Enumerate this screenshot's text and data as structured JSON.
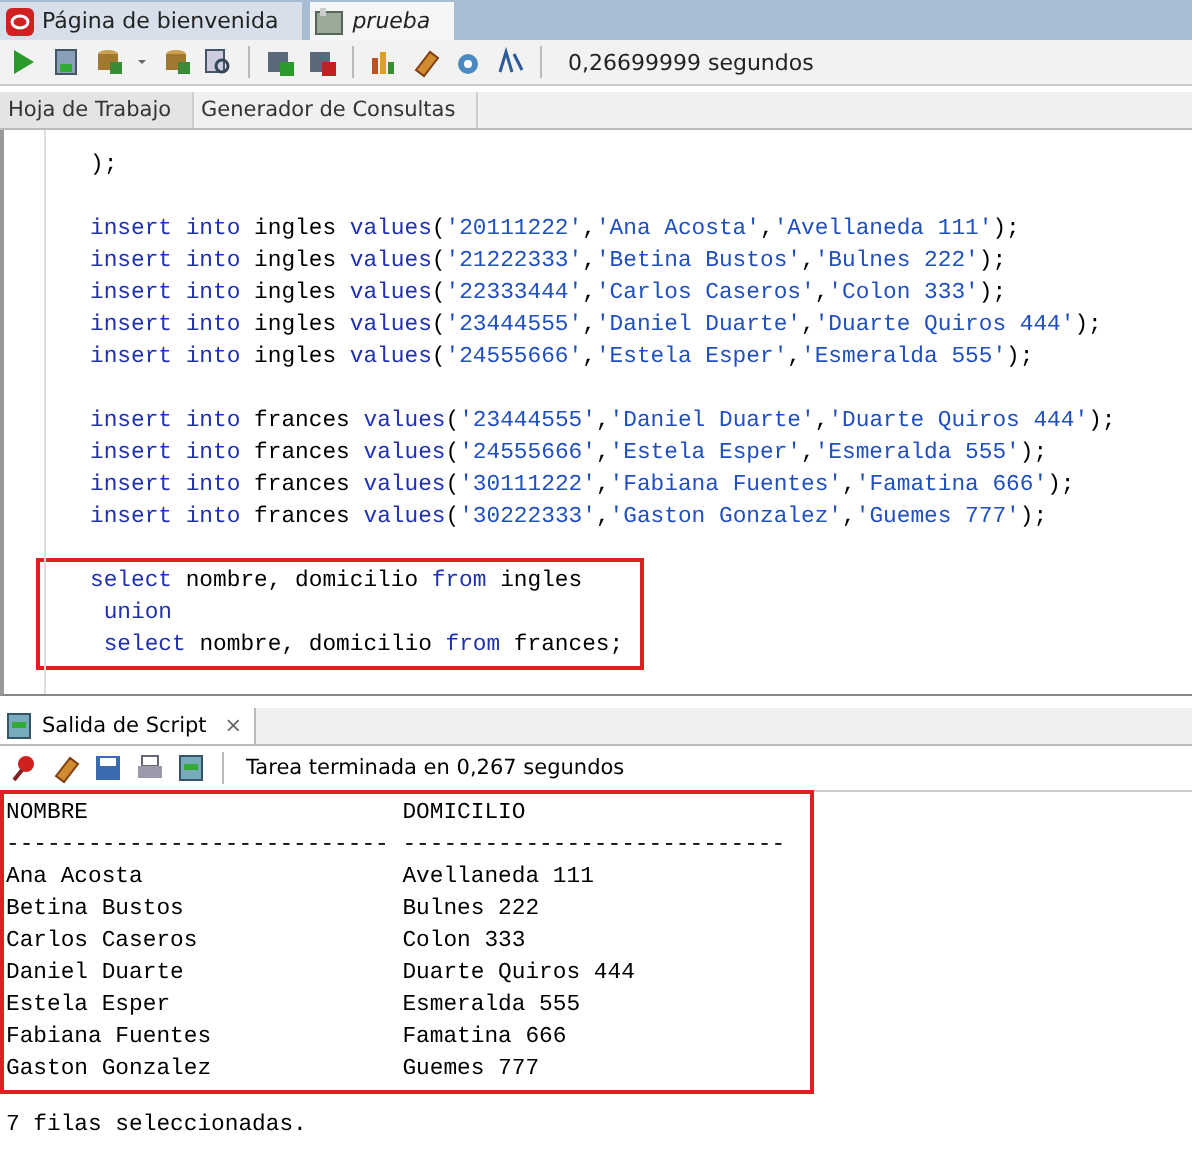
{
  "document_tabs": [
    {
      "label": "Página de bienvenida",
      "selected": false
    },
    {
      "label": "prueba",
      "selected": true
    }
  ],
  "toolbar": {
    "elapsed": "0,26699999 segundos"
  },
  "editor_tabs": [
    {
      "label": "Hoja de Trabajo",
      "selected": true
    },
    {
      "label": "Generador de Consultas",
      "selected": false
    }
  ],
  "editor": {
    "blocks": [
      {
        "highlighted": false,
        "lines": [
          [
            {
              "kind": "plain",
              "text": ");"
            }
          ]
        ]
      },
      {
        "highlighted": false,
        "lines": [
          [
            {
              "kind": "keyword",
              "text": "insert into"
            },
            {
              "kind": "plain",
              "text": " ingles "
            },
            {
              "kind": "keyword",
              "text": "values"
            },
            {
              "kind": "plain",
              "text": "("
            },
            {
              "kind": "string",
              "text": "'20111222'"
            },
            {
              "kind": "plain",
              "text": ","
            },
            {
              "kind": "string",
              "text": "'Ana Acosta'"
            },
            {
              "kind": "plain",
              "text": ","
            },
            {
              "kind": "string",
              "text": "'Avellaneda 111'"
            },
            {
              "kind": "plain",
              "text": ");"
            }
          ],
          [
            {
              "kind": "keyword",
              "text": "insert into"
            },
            {
              "kind": "plain",
              "text": " ingles "
            },
            {
              "kind": "keyword",
              "text": "values"
            },
            {
              "kind": "plain",
              "text": "("
            },
            {
              "kind": "string",
              "text": "'21222333'"
            },
            {
              "kind": "plain",
              "text": ","
            },
            {
              "kind": "string",
              "text": "'Betina Bustos'"
            },
            {
              "kind": "plain",
              "text": ","
            },
            {
              "kind": "string",
              "text": "'Bulnes 222'"
            },
            {
              "kind": "plain",
              "text": ");"
            }
          ],
          [
            {
              "kind": "keyword",
              "text": "insert into"
            },
            {
              "kind": "plain",
              "text": " ingles "
            },
            {
              "kind": "keyword",
              "text": "values"
            },
            {
              "kind": "plain",
              "text": "("
            },
            {
              "kind": "string",
              "text": "'22333444'"
            },
            {
              "kind": "plain",
              "text": ","
            },
            {
              "kind": "string",
              "text": "'Carlos Caseros'"
            },
            {
              "kind": "plain",
              "text": ","
            },
            {
              "kind": "string",
              "text": "'Colon 333'"
            },
            {
              "kind": "plain",
              "text": ");"
            }
          ],
          [
            {
              "kind": "keyword",
              "text": "insert into"
            },
            {
              "kind": "plain",
              "text": " ingles "
            },
            {
              "kind": "keyword",
              "text": "values"
            },
            {
              "kind": "plain",
              "text": "("
            },
            {
              "kind": "string",
              "text": "'23444555'"
            },
            {
              "kind": "plain",
              "text": ","
            },
            {
              "kind": "string",
              "text": "'Daniel Duarte'"
            },
            {
              "kind": "plain",
              "text": ","
            },
            {
              "kind": "string",
              "text": "'Duarte Quiros 444'"
            },
            {
              "kind": "plain",
              "text": ");"
            }
          ],
          [
            {
              "kind": "keyword",
              "text": "insert into"
            },
            {
              "kind": "plain",
              "text": " ingles "
            },
            {
              "kind": "keyword",
              "text": "values"
            },
            {
              "kind": "plain",
              "text": "("
            },
            {
              "kind": "string",
              "text": "'24555666'"
            },
            {
              "kind": "plain",
              "text": ","
            },
            {
              "kind": "string",
              "text": "'Estela Esper'"
            },
            {
              "kind": "plain",
              "text": ","
            },
            {
              "kind": "string",
              "text": "'Esmeralda 555'"
            },
            {
              "kind": "plain",
              "text": ");"
            }
          ]
        ]
      },
      {
        "highlighted": false,
        "lines": [
          [
            {
              "kind": "keyword",
              "text": "insert into"
            },
            {
              "kind": "plain",
              "text": " frances "
            },
            {
              "kind": "keyword",
              "text": "values"
            },
            {
              "kind": "plain",
              "text": "("
            },
            {
              "kind": "string",
              "text": "'23444555'"
            },
            {
              "kind": "plain",
              "text": ","
            },
            {
              "kind": "string",
              "text": "'Daniel Duarte'"
            },
            {
              "kind": "plain",
              "text": ","
            },
            {
              "kind": "string",
              "text": "'Duarte Quiros 444'"
            },
            {
              "kind": "plain",
              "text": ");"
            }
          ],
          [
            {
              "kind": "keyword",
              "text": "insert into"
            },
            {
              "kind": "plain",
              "text": " frances "
            },
            {
              "kind": "keyword",
              "text": "values"
            },
            {
              "kind": "plain",
              "text": "("
            },
            {
              "kind": "string",
              "text": "'24555666'"
            },
            {
              "kind": "plain",
              "text": ","
            },
            {
              "kind": "string",
              "text": "'Estela Esper'"
            },
            {
              "kind": "plain",
              "text": ","
            },
            {
              "kind": "string",
              "text": "'Esmeralda 555'"
            },
            {
              "kind": "plain",
              "text": ");"
            }
          ],
          [
            {
              "kind": "keyword",
              "text": "insert into"
            },
            {
              "kind": "plain",
              "text": " frances "
            },
            {
              "kind": "keyword",
              "text": "values"
            },
            {
              "kind": "plain",
              "text": "("
            },
            {
              "kind": "string",
              "text": "'30111222'"
            },
            {
              "kind": "plain",
              "text": ","
            },
            {
              "kind": "string",
              "text": "'Fabiana Fuentes'"
            },
            {
              "kind": "plain",
              "text": ","
            },
            {
              "kind": "string",
              "text": "'Famatina 666'"
            },
            {
              "kind": "plain",
              "text": ");"
            }
          ],
          [
            {
              "kind": "keyword",
              "text": "insert into"
            },
            {
              "kind": "plain",
              "text": " frances "
            },
            {
              "kind": "keyword",
              "text": "values"
            },
            {
              "kind": "plain",
              "text": "("
            },
            {
              "kind": "string",
              "text": "'30222333'"
            },
            {
              "kind": "plain",
              "text": ","
            },
            {
              "kind": "string",
              "text": "'Gaston Gonzalez'"
            },
            {
              "kind": "plain",
              "text": ","
            },
            {
              "kind": "string",
              "text": "'Guemes 777'"
            },
            {
              "kind": "plain",
              "text": ");"
            }
          ]
        ]
      },
      {
        "highlighted": true,
        "lines": [
          [
            {
              "kind": "keyword",
              "text": "select"
            },
            {
              "kind": "plain",
              "text": " nombre, domicilio "
            },
            {
              "kind": "keyword",
              "text": "from"
            },
            {
              "kind": "plain",
              "text": " ingles"
            }
          ],
          [
            {
              "kind": "keyword",
              "text": " union"
            }
          ],
          [
            {
              "kind": "keyword",
              "text": " select"
            },
            {
              "kind": "plain",
              "text": " nombre, domicilio "
            },
            {
              "kind": "keyword",
              "text": "from"
            },
            {
              "kind": "plain",
              "text": " frances;"
            }
          ]
        ]
      }
    ]
  },
  "output": {
    "tab": {
      "label": "Salida de Script",
      "close": "×"
    },
    "status": "Tarea terminada en 0,267 segundos",
    "columns": [
      "NOMBRE",
      "DOMICILIO"
    ],
    "separators": [
      "----------------------------",
      "----------------------------"
    ],
    "highlighted": true,
    "rows": [
      [
        "Ana Acosta",
        "Avellaneda 111"
      ],
      [
        "Betina Bustos",
        "Bulnes 222"
      ],
      [
        "Carlos Caseros",
        "Colon 333"
      ],
      [
        "Daniel Duarte",
        "Duarte Quiros 444"
      ],
      [
        "Estela Esper",
        "Esmeralda 555"
      ],
      [
        "Fabiana Fuentes",
        "Famatina 666"
      ],
      [
        "Gaston Gonzalez",
        "Guemes 777"
      ]
    ],
    "footer": "7 filas seleccionadas."
  }
}
